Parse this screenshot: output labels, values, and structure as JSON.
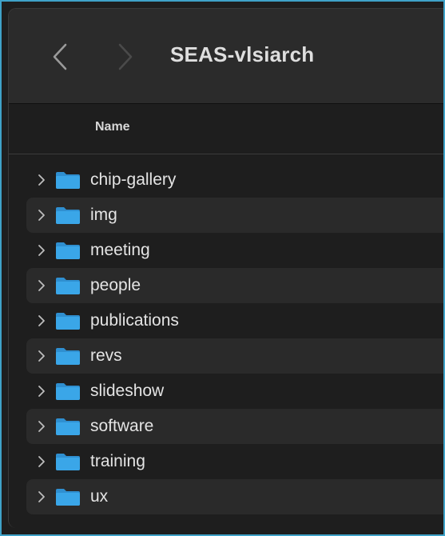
{
  "window": {
    "title": "SEAS-vlsiarch"
  },
  "toolbar": {
    "back_icon": "chevron-left-icon",
    "forward_icon": "chevron-right-icon"
  },
  "columns": {
    "name_header": "Name"
  },
  "items": [
    {
      "name": "chip-gallery",
      "icon": "folder-icon"
    },
    {
      "name": "img",
      "icon": "folder-icon"
    },
    {
      "name": "meeting",
      "icon": "folder-icon"
    },
    {
      "name": "people",
      "icon": "folder-icon"
    },
    {
      "name": "publications",
      "icon": "folder-icon"
    },
    {
      "name": "revs",
      "icon": "folder-icon"
    },
    {
      "name": "slideshow",
      "icon": "folder-icon"
    },
    {
      "name": "software",
      "icon": "folder-icon"
    },
    {
      "name": "training",
      "icon": "folder-icon"
    },
    {
      "name": "ux",
      "icon": "folder-icon"
    }
  ],
  "colors": {
    "frame_border": "#3fa2c8",
    "folder_blue": "#3aa6e8",
    "window_bg": "#1e1e1e",
    "toolbar_bg": "#2b2b2b"
  }
}
